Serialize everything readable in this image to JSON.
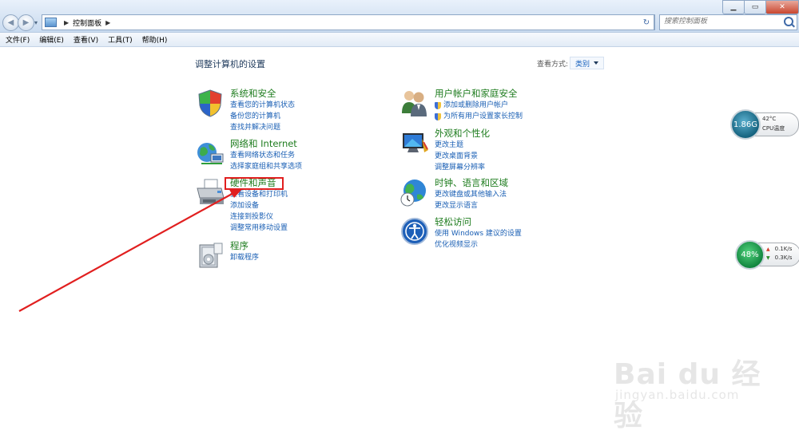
{
  "window": {
    "minimize_icon": "minimize-icon",
    "maximize_icon": "maximize-icon",
    "close_icon": "close-icon"
  },
  "address_bar": {
    "breadcrumb": "控制面板",
    "search_placeholder": "搜索控制面板"
  },
  "menu": [
    "文件(F)",
    "编辑(E)",
    "查看(V)",
    "工具(T)",
    "帮助(H)"
  ],
  "main": {
    "title": "调整计算机的设置",
    "view_by_label": "查看方式:",
    "view_by_value": "类别"
  },
  "categories": {
    "system_security": {
      "title": "系统和安全",
      "icon": "shield-icon",
      "links": [
        "查看您的计算机状态",
        "备份您的计算机",
        "查找并解决问题"
      ]
    },
    "network": {
      "title": "网络和 Internet",
      "icon": "network-globe-icon",
      "links": [
        "查看网络状态和任务",
        "选择家庭组和共享选项"
      ]
    },
    "hardware_sound": {
      "title": "硬件和声音",
      "icon": "printer-icon",
      "links": [
        "查看设备和打印机",
        "添加设备",
        "连接到投影仪",
        "调整常用移动设置"
      ]
    },
    "programs": {
      "title": "程序",
      "icon": "programs-icon",
      "links": [
        "卸载程序"
      ]
    },
    "user_accounts": {
      "title": "用户帐户和家庭安全",
      "icon": "users-icon",
      "links": [
        "添加或删除用户帐户",
        "为所有用户设置家长控制"
      ]
    },
    "appearance": {
      "title": "外观和个性化",
      "icon": "display-icon",
      "links": [
        "更改主题",
        "更改桌面背景",
        "调整屏幕分辨率"
      ]
    },
    "clock_region": {
      "title": "时钟、语言和区域",
      "icon": "clock-globe-icon",
      "links": [
        "更改键盘或其他输入法",
        "更改显示语言"
      ]
    },
    "ease_of_access": {
      "title": "轻松访问",
      "icon": "ease-of-access-icon",
      "links": [
        "使用 Windows 建议的设置",
        "优化视频显示"
      ]
    }
  },
  "gadgets": {
    "cpu": {
      "value": "1.86G",
      "temperature": "42°C",
      "label": "CPU温度"
    },
    "net": {
      "value": "48%",
      "upload": "0.1K/s",
      "download": "0.3K/s"
    }
  },
  "watermark": {
    "brand": "Bai du 经验",
    "url": "jingyan.baidu.com"
  },
  "colors": {
    "category_title": "#1e7c1e",
    "link": "#1a5fb4",
    "annotation": "#e11f1f"
  }
}
